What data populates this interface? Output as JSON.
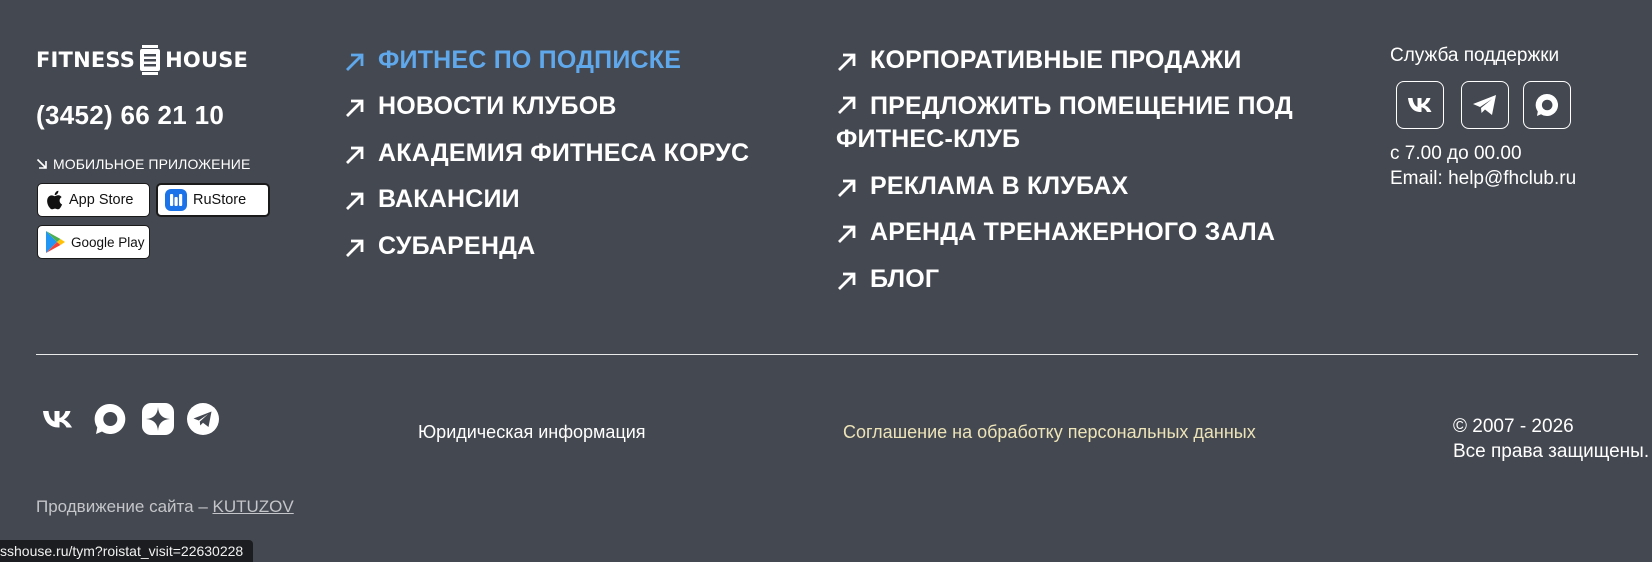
{
  "logo": {
    "left": "FITNESS",
    "right": "HOUSE"
  },
  "phone": "(3452) 66 21 10",
  "mobile_app": {
    "label": "МОБИЛЬНОЕ ПРИЛОЖЕНИЕ",
    "stores": [
      {
        "label": "App Store",
        "icon": "apple-icon"
      },
      {
        "label": "RuStore",
        "icon": "rustore-icon"
      },
      {
        "label": "Google Play",
        "icon": "google-play-icon"
      }
    ]
  },
  "nav_col1": [
    "ФИТНЕС ПО ПОДПИСКЕ",
    "НОВОСТИ КЛУБОВ",
    "АКАДЕМИЯ ФИТНЕСА КОРУС",
    "ВАКАНСИИ",
    "СУБАРЕНДА"
  ],
  "nav_col2": [
    "КОРПОРАТИВНЫЕ ПРОДАЖИ",
    "ПРЕДЛОЖИТЬ ПОМЕЩЕНИЕ ПОД ФИТНЕС-КЛУБ",
    "РЕКЛАМА В КЛУБАХ",
    "АРЕНДА ТРЕНАЖЕРНОГО ЗАЛА",
    "БЛОГ"
  ],
  "support": {
    "title": "Служба поддержки",
    "hours": "с 7.00 до 00.00",
    "email": "Email: help@fhclub.ru",
    "buttons": [
      "vk-icon",
      "telegram-icon",
      "max-messenger-icon"
    ]
  },
  "social": [
    "vk-icon",
    "max-messenger-icon",
    "dzen-icon",
    "telegram-icon"
  ],
  "footer": {
    "legal": "Юридическая информация",
    "consent": "Соглашение на обработку персональных данных",
    "copyright_years": "© 2007 - 2026",
    "copyright_rights": "Все права защищены."
  },
  "promo": {
    "text": "Продвижение сайта – ",
    "link": "KUTUZOV"
  },
  "status_url": "sshouse.ru/tym?roistat_visit=22630228",
  "colors": {
    "background": "#444850",
    "accent": "#60a8ec",
    "consent_text": "#ece3b8"
  }
}
